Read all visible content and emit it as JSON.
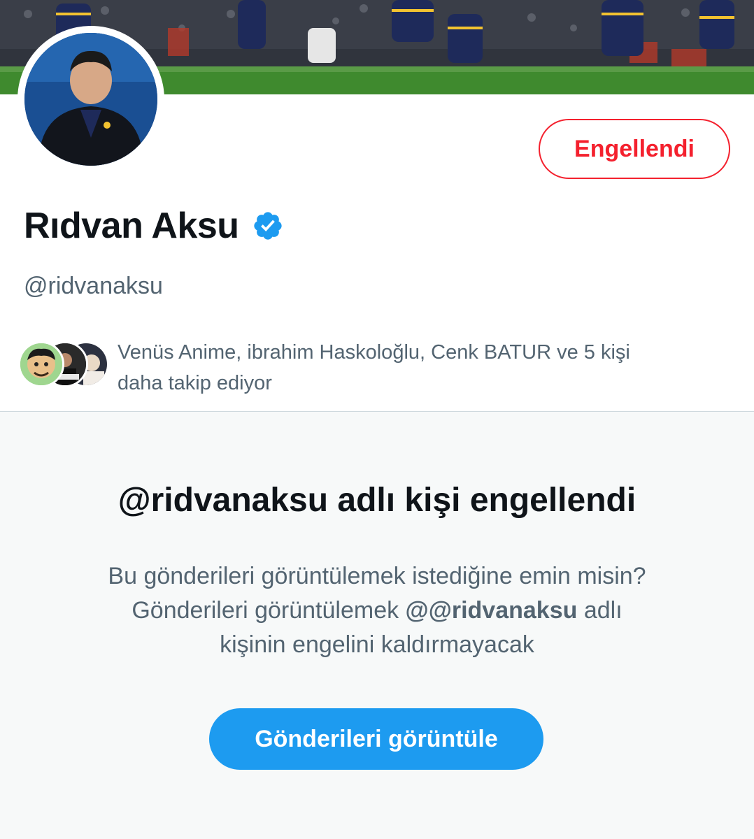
{
  "profile": {
    "display_name": "Rıdvan Aksu",
    "handle": "@ridvanaksu",
    "verified": true,
    "blocked_button_label": "Engellendi"
  },
  "followers_you_know": {
    "line1": "Venüs Anime, ibrahim Haskoloğlu, Cenk BATUR ve 5 kişi",
    "line2": "daha takip ediyor"
  },
  "blocked_notice": {
    "title": "@ridvanaksu adlı kişi engellendi",
    "line1": "Bu gönderileri görüntülemek istediğine emin misin?",
    "line2_prefix": "Gönderileri görüntülemek ",
    "line2_handle": "@@ridvanaksu",
    "line2_suffix": " adlı",
    "line3": "kişinin engelini kaldırmayacak",
    "view_button_label": "Gönderileri görüntüle"
  },
  "colors": {
    "blocked_red": "#f4212e",
    "primary_blue": "#1d9bf0",
    "text_primary": "#0f1419",
    "text_secondary": "#536471",
    "panel_bg": "#f7f9f9"
  },
  "icons": {
    "verified": "verified-badge-icon"
  }
}
